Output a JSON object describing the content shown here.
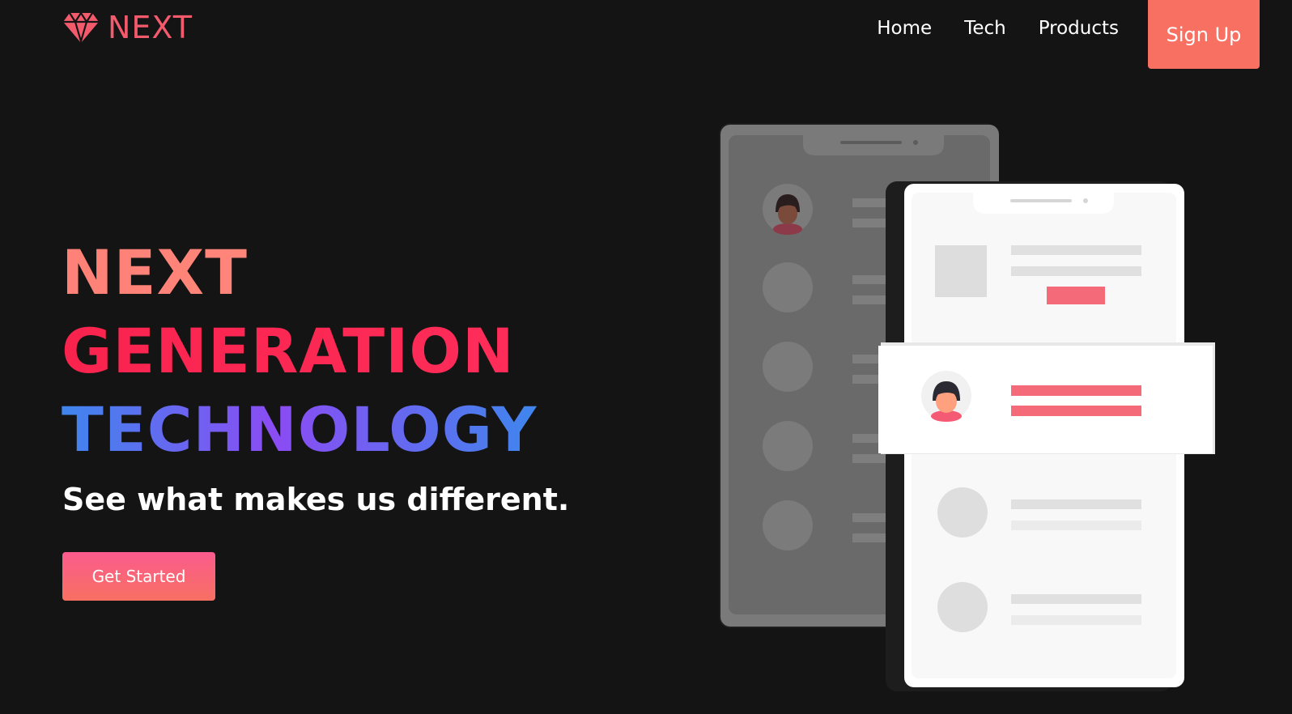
{
  "brand": {
    "name": "NEXT",
    "icon": "diamond-icon",
    "color": "#f35b6d"
  },
  "nav": {
    "links": [
      "Home",
      "Tech",
      "Products"
    ],
    "signup_label": "Sign Up",
    "signup_color": "#f77062"
  },
  "hero": {
    "title_lines": [
      "NEXT",
      "GENERATION",
      "TECHNOLOGY"
    ],
    "subtitle": "See what makes us different.",
    "cta_label": "Get Started"
  },
  "colors": {
    "background": "#141414",
    "accent_pink": "#fb5b8d",
    "accent_coral": "#f77062",
    "accent_blue": "#3f86ed",
    "accent_purple": "#8b4cf3"
  }
}
